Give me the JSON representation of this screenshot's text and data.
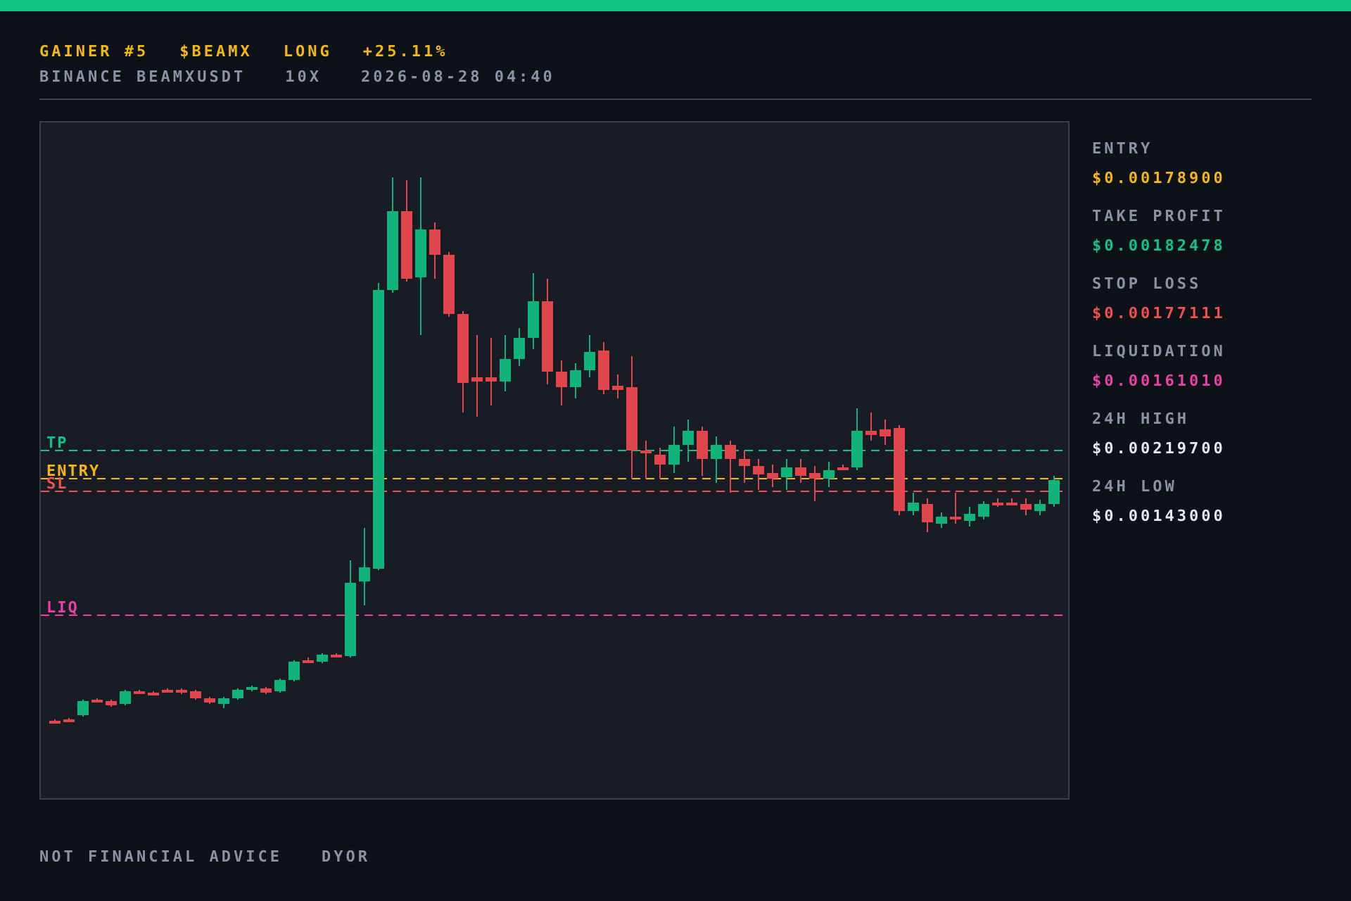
{
  "header": {
    "title": [
      "GAINER #5",
      "$BEAMX",
      "LONG",
      "+25.11%"
    ],
    "subtitle": [
      "BINANCE BEAMXUSDT",
      "10X",
      "2026-08-28 04:40"
    ]
  },
  "chart": {
    "levels": [
      {
        "label": "TP",
        "color": "#12c483"
      },
      {
        "label": "ENTRY",
        "color": "#f5b80f"
      },
      {
        "label": "SL",
        "color": "#f0504f"
      },
      {
        "label": "LIQ",
        "color": "#ee3fa8"
      }
    ]
  },
  "stats": [
    {
      "label": "ENTRY",
      "value": "$0.00178900",
      "color": "#f5b80f"
    },
    {
      "label": "TAKE PROFIT",
      "value": "$0.00182478",
      "color": "#12c483"
    },
    {
      "label": "STOP LOSS",
      "value": "$0.00177111",
      "color": "#f0504f"
    },
    {
      "label": "LIQUIDATION",
      "value": "$0.00161010",
      "color": "#ee3fa8"
    },
    {
      "label": "24H HIGH",
      "value": "$0.00219700",
      "color": "#e6e8ee"
    },
    {
      "label": "24H LOW",
      "value": "$0.00143000",
      "color": "#e6e8ee"
    }
  ],
  "footer": [
    "NOT FINANCIAL ADVICE",
    "DYOR"
  ]
}
